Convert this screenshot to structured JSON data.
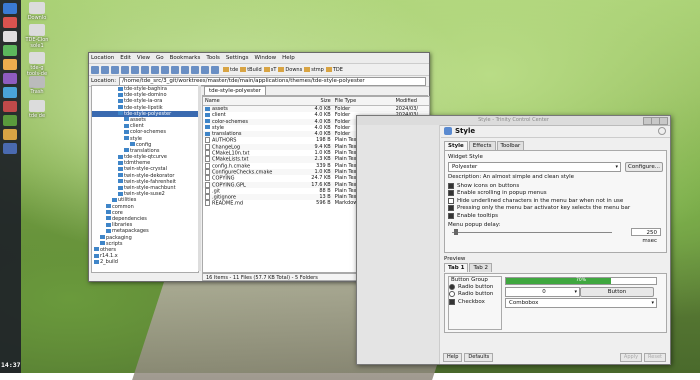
{
  "desktop": {
    "icons": [
      "Downlo",
      "TDE-Clon sole1",
      "tde-g tools-de",
      "Trash",
      "tde de"
    ]
  },
  "kicker": {
    "clock_time": "14:37"
  },
  "file_manager": {
    "menu": [
      "Location",
      "Edit",
      "View",
      "Go",
      "Bookmarks",
      "Tools",
      "Settings",
      "Window",
      "Help"
    ],
    "bookmarks": [
      "tde",
      "tBuild",
      "sT",
      "Downs",
      "stmp",
      "TDE"
    ],
    "location_label": "Location:",
    "location_path": "/home/tde_src/3_git/worktrees/master/tde/main/applications/themes/tde-style-polyester",
    "tab_label": "tde-style-polyester",
    "tree": [
      {
        "label": "tde-style-baghira",
        "indent": 4
      },
      {
        "label": "tde-style-domino",
        "indent": 4
      },
      {
        "label": "tde-style-ia-ora",
        "indent": 4
      },
      {
        "label": "tde-style-lipstik",
        "indent": 4
      },
      {
        "label": "tde-style-polyester",
        "indent": 4,
        "selected": true
      },
      {
        "label": "assets",
        "indent": 5
      },
      {
        "label": "client",
        "indent": 5
      },
      {
        "label": "color-schemes",
        "indent": 5
      },
      {
        "label": "style",
        "indent": 5
      },
      {
        "label": "config",
        "indent": 6
      },
      {
        "label": "translations",
        "indent": 5
      },
      {
        "label": "tde-style-qtcurve",
        "indent": 4
      },
      {
        "label": "tdmtheme",
        "indent": 4
      },
      {
        "label": "twin-style-crystal",
        "indent": 4
      },
      {
        "label": "twin-style-dekorator",
        "indent": 4
      },
      {
        "label": "twin-style-fahrenheit",
        "indent": 4
      },
      {
        "label": "twin-style-machbunt",
        "indent": 4
      },
      {
        "label": "twin-style-suse2",
        "indent": 4
      },
      {
        "label": "utilities",
        "indent": 3
      },
      {
        "label": "common",
        "indent": 2
      },
      {
        "label": "core",
        "indent": 2
      },
      {
        "label": "dependencies",
        "indent": 2
      },
      {
        "label": "libraries",
        "indent": 2
      },
      {
        "label": "metapackages",
        "indent": 2
      },
      {
        "label": "packaging",
        "indent": 1
      },
      {
        "label": "scripts",
        "indent": 1
      },
      {
        "label": "others",
        "indent": 0
      },
      {
        "label": "r14.1.x",
        "indent": 0
      },
      {
        "label": "2_build",
        "indent": 0
      }
    ],
    "columns": [
      "Name",
      "Size",
      "File Type",
      "Modified"
    ],
    "files": [
      {
        "name": "assets",
        "size": "4.0 KB",
        "type": "Folder",
        "modified": "2024/03/",
        "folder": true
      },
      {
        "name": "client",
        "size": "4.0 KB",
        "type": "Folder",
        "modified": "2024/03/",
        "folder": true
      },
      {
        "name": "color-schemes",
        "size": "4.0 KB",
        "type": "Folder",
        "modified": "2024/03/",
        "folder": true
      },
      {
        "name": "style",
        "size": "4.0 KB",
        "type": "Folder",
        "modified": "2024/03/",
        "folder": true
      },
      {
        "name": "translations",
        "size": "4.0 KB",
        "type": "Folder",
        "modified": "2024/03/",
        "folder": true
      },
      {
        "name": "AUTHORS",
        "size": "198 B",
        "type": "Plain Text Document",
        "modified": "2024/03/",
        "folder": false
      },
      {
        "name": "ChangeLog",
        "size": "9.4 KB",
        "type": "Plain Text Document",
        "modified": "2024/03/",
        "folder": false
      },
      {
        "name": "CMakeL10n.txt",
        "size": "1.0 KB",
        "type": "Plain Text Document",
        "modified": "2024/03/",
        "folder": false
      },
      {
        "name": "CMakeLists.txt",
        "size": "2.3 KB",
        "type": "Plain Text Document",
        "modified": "2024/03/",
        "folder": false
      },
      {
        "name": "config.h.cmake",
        "size": "339 B",
        "type": "Plain Text Document",
        "modified": "2024/03/",
        "folder": false
      },
      {
        "name": "ConfigureChecks.cmake",
        "size": "1.0 KB",
        "type": "Plain Text Document",
        "modified": "2024/03/",
        "folder": false
      },
      {
        "name": "COPYING",
        "size": "24.7 KB",
        "type": "Plain Text Document",
        "modified": "2024/03/",
        "folder": false
      },
      {
        "name": "COPYING.GPL",
        "size": "17.6 KB",
        "type": "Plain Text Document",
        "modified": "2024/03/",
        "folder": false
      },
      {
        "name": ".git",
        "size": "88 B",
        "type": "Plain Text Document",
        "modified": "2024/03/",
        "folder": false
      },
      {
        "name": ".gitignore",
        "size": "13 B",
        "type": "Plain Text Document",
        "modified": "2024/03/",
        "folder": false
      },
      {
        "name": "README.md",
        "size": "596 B",
        "type": "Markdown document",
        "modified": "2024/03/",
        "folder": false
      }
    ],
    "status": "16 Items - 11 Files (57.7 KB Total) - 5 Folders"
  },
  "style_dialog": {
    "window_title": "Style - Trinity Control Center",
    "header": "Style",
    "tabs": [
      "Style",
      "Effects",
      "Toolbar"
    ],
    "widget_style_label": "Widget Style",
    "widget_style_value": "Polyester",
    "configure_label": "Configure...",
    "description": "Description: An almost simple and clean style",
    "options": [
      {
        "label": "Show icons on buttons",
        "checked": true
      },
      {
        "label": "Enable scrolling in popup menus",
        "checked": true
      },
      {
        "label": "Hide underlined characters in the menu bar when not in use",
        "checked": false
      },
      {
        "label": "Pressing only the menu bar activator key selects the menu bar",
        "checked": true
      },
      {
        "label": "Enable tooltips",
        "checked": true
      }
    ],
    "popup_delay_label": "Menu popup delay:",
    "popup_delay_value": "250 msec",
    "preview_label": "Preview",
    "preview_tabs": [
      "Tab 1",
      "Tab 2"
    ],
    "button_group_label": "Button Group",
    "radio1": "Radio button",
    "radio2": "Radio button",
    "checkbox": "Checkbox",
    "progress_label": "70%",
    "progress_value": 0.7,
    "spin_value": "0",
    "button_label": "Button",
    "combo_label": "Combobox",
    "bottom_buttons": [
      "Help",
      "Defaults",
      "Apply",
      "Reset"
    ]
  }
}
